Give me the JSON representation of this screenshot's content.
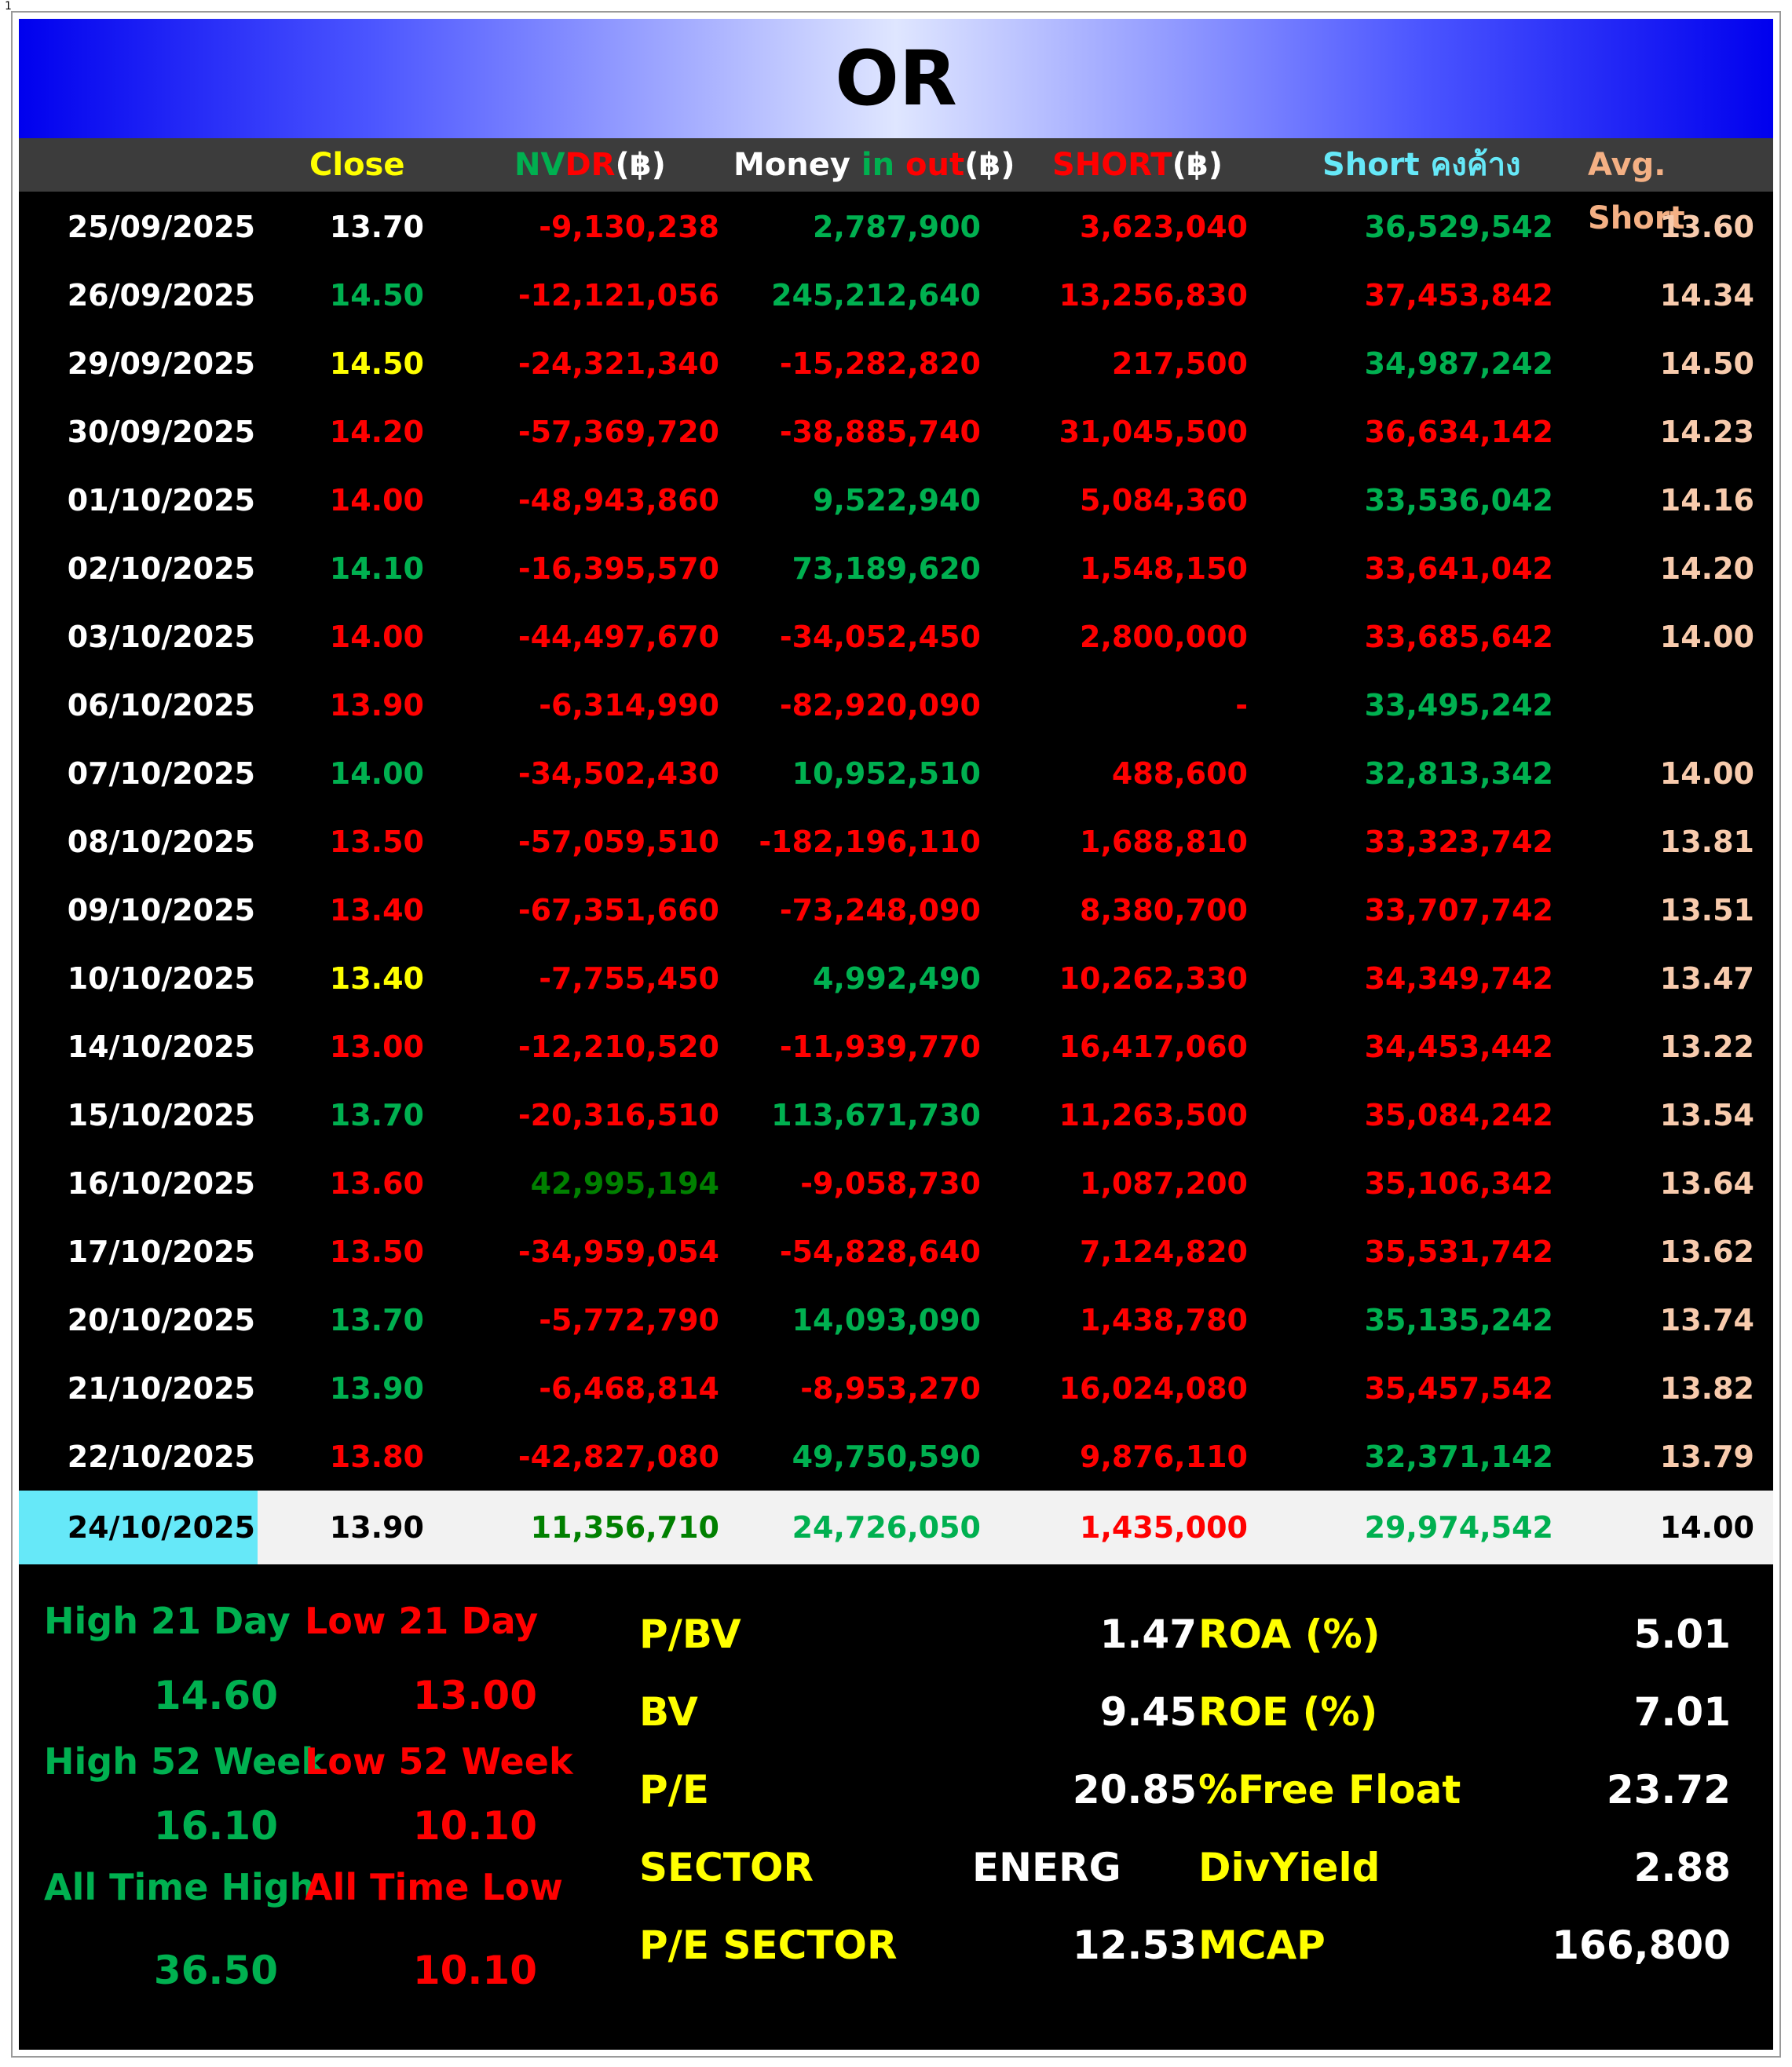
{
  "page_number": "1",
  "title": "OR",
  "columns": {
    "close": "Close",
    "nvdr_a": "NV",
    "nvdr_b": "DR",
    "nvdr_c": "(฿)",
    "money_a": "Money ",
    "money_b": "in ",
    "money_c": "out",
    "money_d": "(฿)",
    "short_a": "SHORT",
    "short_b": "(฿)",
    "short_bal_a": "Short ",
    "short_bal_b": "คงค้าง",
    "avg_short": "Avg. Short"
  },
  "rows": [
    {
      "date": "25/09/2025",
      "close": "13.70",
      "close_color": "#ffffff",
      "nvdr": "-9,130,238",
      "nvdr_color": "#ff0000",
      "money": "2,787,900",
      "money_color": "#00b050",
      "short": "3,623,040",
      "short_bal": "36,529,542",
      "short_bal_color": "#00b050",
      "avg": "13.60"
    },
    {
      "date": "26/09/2025",
      "close": "14.50",
      "close_color": "#00b050",
      "nvdr": "-12,121,056",
      "nvdr_color": "#ff0000",
      "money": "245,212,640",
      "money_color": "#00b050",
      "short": "13,256,830",
      "short_bal": "37,453,842",
      "short_bal_color": "#ff0000",
      "avg": "14.34"
    },
    {
      "date": "29/09/2025",
      "close": "14.50",
      "close_color": "#ffff00",
      "nvdr": "-24,321,340",
      "nvdr_color": "#ff0000",
      "money": "-15,282,820",
      "money_color": "#ff0000",
      "short": "217,500",
      "short_bal": "34,987,242",
      "short_bal_color": "#00b050",
      "avg": "14.50"
    },
    {
      "date": "30/09/2025",
      "close": "14.20",
      "close_color": "#ff0000",
      "nvdr": "-57,369,720",
      "nvdr_color": "#ff0000",
      "money": "-38,885,740",
      "money_color": "#ff0000",
      "short": "31,045,500",
      "short_bal": "36,634,142",
      "short_bal_color": "#ff0000",
      "avg": "14.23"
    },
    {
      "date": "01/10/2025",
      "close": "14.00",
      "close_color": "#ff0000",
      "nvdr": "-48,943,860",
      "nvdr_color": "#ff0000",
      "money": "9,522,940",
      "money_color": "#00b050",
      "short": "5,084,360",
      "short_bal": "33,536,042",
      "short_bal_color": "#00b050",
      "avg": "14.16"
    },
    {
      "date": "02/10/2025",
      "close": "14.10",
      "close_color": "#00b050",
      "nvdr": "-16,395,570",
      "nvdr_color": "#ff0000",
      "money": "73,189,620",
      "money_color": "#00b050",
      "short": "1,548,150",
      "short_bal": "33,641,042",
      "short_bal_color": "#ff0000",
      "avg": "14.20"
    },
    {
      "date": "03/10/2025",
      "close": "14.00",
      "close_color": "#ff0000",
      "nvdr": "-44,497,670",
      "nvdr_color": "#ff0000",
      "money": "-34,052,450",
      "money_color": "#ff0000",
      "short": "2,800,000",
      "short_bal": "33,685,642",
      "short_bal_color": "#ff0000",
      "avg": "14.00"
    },
    {
      "date": "06/10/2025",
      "close": "13.90",
      "close_color": "#ff0000",
      "nvdr": "-6,314,990",
      "nvdr_color": "#ff0000",
      "money": "-82,920,090",
      "money_color": "#ff0000",
      "short": "-",
      "short_bal": "33,495,242",
      "short_bal_color": "#00b050",
      "avg": ""
    },
    {
      "date": "07/10/2025",
      "close": "14.00",
      "close_color": "#00b050",
      "nvdr": "-34,502,430",
      "nvdr_color": "#ff0000",
      "money": "10,952,510",
      "money_color": "#00b050",
      "short": "488,600",
      "short_bal": "32,813,342",
      "short_bal_color": "#00b050",
      "avg": "14.00"
    },
    {
      "date": "08/10/2025",
      "close": "13.50",
      "close_color": "#ff0000",
      "nvdr": "-57,059,510",
      "nvdr_color": "#ff0000",
      "money": "-182,196,110",
      "money_color": "#ff0000",
      "short": "1,688,810",
      "short_bal": "33,323,742",
      "short_bal_color": "#ff0000",
      "avg": "13.81"
    },
    {
      "date": "09/10/2025",
      "close": "13.40",
      "close_color": "#ff0000",
      "nvdr": "-67,351,660",
      "nvdr_color": "#ff0000",
      "money": "-73,248,090",
      "money_color": "#ff0000",
      "short": "8,380,700",
      "short_bal": "33,707,742",
      "short_bal_color": "#ff0000",
      "avg": "13.51"
    },
    {
      "date": "10/10/2025",
      "close": "13.40",
      "close_color": "#ffff00",
      "nvdr": "-7,755,450",
      "nvdr_color": "#ff0000",
      "money": "4,992,490",
      "money_color": "#00b050",
      "short": "10,262,330",
      "short_bal": "34,349,742",
      "short_bal_color": "#ff0000",
      "avg": "13.47"
    },
    {
      "date": "14/10/2025",
      "close": "13.00",
      "close_color": "#ff0000",
      "nvdr": "-12,210,520",
      "nvdr_color": "#ff0000",
      "money": "-11,939,770",
      "money_color": "#ff0000",
      "short": "16,417,060",
      "short_bal": "34,453,442",
      "short_bal_color": "#ff0000",
      "avg": "13.22"
    },
    {
      "date": "15/10/2025",
      "close": "13.70",
      "close_color": "#00b050",
      "nvdr": "-20,316,510",
      "nvdr_color": "#ff0000",
      "money": "113,671,730",
      "money_color": "#00b050",
      "short": "11,263,500",
      "short_bal": "35,084,242",
      "short_bal_color": "#ff0000",
      "avg": "13.54"
    },
    {
      "date": "16/10/2025",
      "close": "13.60",
      "close_color": "#ff0000",
      "nvdr": "42,995,194",
      "nvdr_color": "#008000",
      "money": "-9,058,730",
      "money_color": "#ff0000",
      "short": "1,087,200",
      "short_bal": "35,106,342",
      "short_bal_color": "#ff0000",
      "avg": "13.64"
    },
    {
      "date": "17/10/2025",
      "close": "13.50",
      "close_color": "#ff0000",
      "nvdr": "-34,959,054",
      "nvdr_color": "#ff0000",
      "money": "-54,828,640",
      "money_color": "#ff0000",
      "short": "7,124,820",
      "short_bal": "35,531,742",
      "short_bal_color": "#ff0000",
      "avg": "13.62"
    },
    {
      "date": "20/10/2025",
      "close": "13.70",
      "close_color": "#00b050",
      "nvdr": "-5,772,790",
      "nvdr_color": "#ff0000",
      "money": "14,093,090",
      "money_color": "#00b050",
      "short": "1,438,780",
      "short_bal": "35,135,242",
      "short_bal_color": "#00b050",
      "avg": "13.74"
    },
    {
      "date": "21/10/2025",
      "close": "13.90",
      "close_color": "#00b050",
      "nvdr": "-6,468,814",
      "nvdr_color": "#ff0000",
      "money": "-8,953,270",
      "money_color": "#ff0000",
      "short": "16,024,080",
      "short_bal": "35,457,542",
      "short_bal_color": "#ff0000",
      "avg": "13.82"
    },
    {
      "date": "22/10/2025",
      "close": "13.80",
      "close_color": "#ff0000",
      "nvdr": "-42,827,080",
      "nvdr_color": "#ff0000",
      "money": "49,750,590",
      "money_color": "#00b050",
      "short": "9,876,110",
      "short_bal": "32,371,142",
      "short_bal_color": "#00b050",
      "avg": "13.79"
    }
  ],
  "last_row": {
    "date": "24/10/2025",
    "close": "13.90",
    "nvdr": "11,356,710",
    "money": "24,726,050",
    "short": "1,435,000",
    "short_bal": "29,974,542",
    "avg": "14.00"
  },
  "ranges": {
    "high21_label": "High 21 Day",
    "low21_label": "Low 21 Day",
    "high21": "14.60",
    "low21": "13.00",
    "high52_label": "High 52 Week",
    "low52_label": "Low 52 Week",
    "high52": "16.10",
    "low52": "10.10",
    "ath_label": "All Time High",
    "atl_label": "All Time Low",
    "ath": "36.50",
    "atl": "10.10"
  },
  "stats": {
    "pbv_label": "P/BV",
    "pbv": "1.47",
    "bv_label": "BV",
    "bv": "9.45",
    "pe_label": "P/E",
    "pe": "20.85",
    "sector_label": "SECTOR",
    "sector": "ENERG",
    "pe_sector_label": "P/E SECTOR",
    "pe_sector": "12.53",
    "roa_label": "ROA (%)",
    "roa": "5.01",
    "roe_label": "ROE (%)",
    "roe": "7.01",
    "free_float_label": "%Free Float",
    "free_float": "23.72",
    "div_yield_label": "DivYield",
    "div_yield": "2.88",
    "mcap_label": "MCAP",
    "mcap": "166,800"
  }
}
